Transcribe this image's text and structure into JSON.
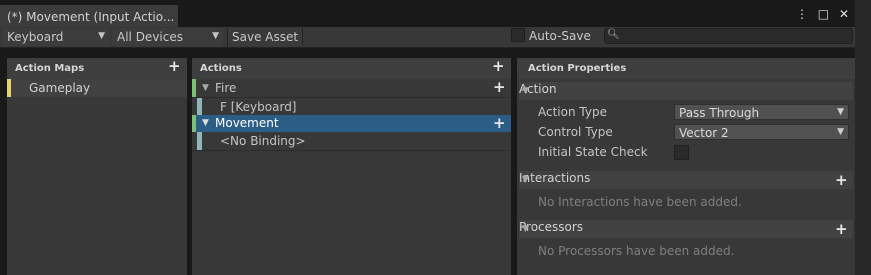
{
  "window": {
    "tab_title": "(*) Movement (Input Actio...",
    "controls": {
      "menu": "⋮",
      "maximize": "□",
      "close": "✕"
    }
  },
  "toolbar": {
    "scheme_select": "Keyboard",
    "device_select": "All Devices",
    "save_asset": "Save Asset",
    "auto_save_label": "Auto-Save",
    "auto_save_checked": false,
    "search_placeholder": ""
  },
  "action_maps": {
    "header": "Action Maps",
    "items": [
      {
        "label": "Gameplay",
        "color": "#e6d46a"
      }
    ]
  },
  "actions": {
    "header": "Actions",
    "items": [
      {
        "label": "Fire",
        "kind": "action",
        "color": "#7dbf7a"
      },
      {
        "label": "F [Keyboard]",
        "kind": "binding",
        "color": "#8fb7b7"
      },
      {
        "label": "Movement",
        "kind": "action",
        "selected": true,
        "color": "#7dbf7a"
      },
      {
        "label": "<No Binding>",
        "kind": "binding",
        "color": "#8fb7b7"
      }
    ]
  },
  "action_properties": {
    "header": "Action Properties",
    "action_section": {
      "title": "Action",
      "fields": [
        {
          "label": "Action Type",
          "value": "Pass Through"
        },
        {
          "label": "Control Type",
          "value": "Vector 2"
        }
      ],
      "initial_state_check": {
        "label": "Initial State Check",
        "checked": false
      }
    },
    "interactions": {
      "title": "Interactions",
      "empty_text": "No Interactions have been added."
    },
    "processors": {
      "title": "Processors",
      "empty_text": "No Processors have been added."
    }
  },
  "colors": {
    "selected_row": "#2c5d87",
    "panel": "#383838",
    "header": "#3e3e3e"
  }
}
